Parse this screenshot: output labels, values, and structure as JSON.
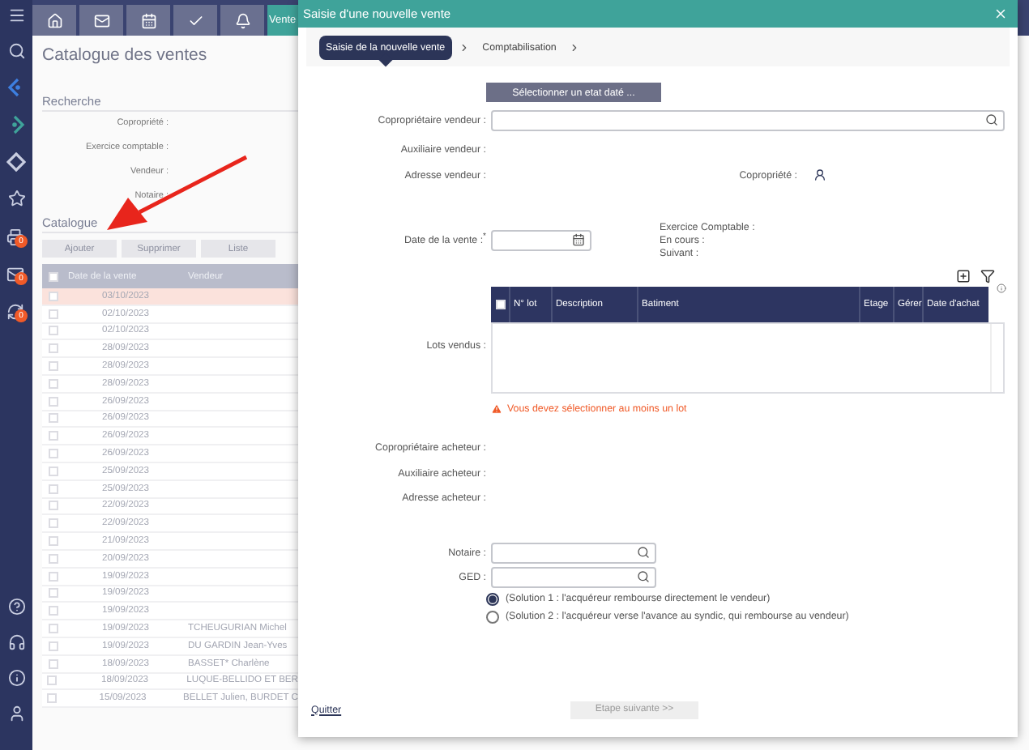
{
  "sidebar": {
    "badges": [
      "0",
      "0",
      "0"
    ]
  },
  "top_tabs": [
    {
      "kind": "home",
      "selected": false
    },
    {
      "kind": "mail",
      "selected": false
    },
    {
      "kind": "calendar",
      "selected": false
    },
    {
      "kind": "check",
      "selected": false
    },
    {
      "kind": "bell",
      "selected": false
    },
    {
      "kind": "text",
      "label": "Vente",
      "selected": true
    }
  ],
  "page_title": "Catalogue des ventes",
  "search": {
    "title": "Recherche",
    "fields": [
      "Copropriété :",
      "Exercice comptable :",
      "Vendeur :",
      "Notaire :"
    ]
  },
  "catalogue": {
    "title": "Catalogue",
    "buttons": [
      "Ajouter",
      "Supprimer",
      "Liste"
    ],
    "columns": [
      "Date de la vente",
      "Vendeur"
    ],
    "header_checked": false,
    "rows": [
      {
        "date": "03/10/2023",
        "selected": true
      },
      {
        "date": "02/10/2023",
        "selected": false
      },
      {
        "date": "02/10/2023",
        "selected": false
      },
      {
        "date": "28/09/2023",
        "selected": false
      },
      {
        "date": "28/09/2023",
        "selected": false
      },
      {
        "date": "28/09/2023",
        "selected": false
      },
      {
        "date": "26/09/2023",
        "selected": false
      },
      {
        "date": "26/09/2023",
        "selected": false
      },
      {
        "date": "26/09/2023",
        "selected": false
      },
      {
        "date": "26/09/2023",
        "selected": false
      },
      {
        "date": "25/09/2023",
        "selected": false
      },
      {
        "date": "25/09/2023",
        "selected": false
      },
      {
        "date": "22/09/2023",
        "selected": false
      },
      {
        "date": "22/09/2023",
        "selected": false
      },
      {
        "date": "21/09/2023",
        "selected": false
      },
      {
        "date": "20/09/2023",
        "selected": false
      },
      {
        "date": "19/09/2023",
        "selected": false
      },
      {
        "date": "19/09/2023",
        "selected": false
      },
      {
        "date": "19/09/2023",
        "selected": false
      },
      {
        "date": "19/09/2023",
        "vendor": "TCHEUGURIAN Michel",
        "selected": false
      },
      {
        "date": "19/09/2023",
        "vendor": "DU GARDIN Jean-Yves",
        "selected": false
      },
      {
        "date": "18/09/2023",
        "vendor": "BASSET* Charlène",
        "selected": false
      },
      {
        "date": "18/09/2023",
        "vendor": "LUQUE-BELLIDO ET BER",
        "selected": false
      },
      {
        "date": "15/09/2023",
        "vendor": "BELLET Julien, BURDET C",
        "selected": false
      }
    ]
  },
  "dialog": {
    "title": "Saisie d'une nouvelle vente",
    "steps": [
      {
        "label": "Saisie de la nouvelle vente",
        "selected": true
      },
      {
        "label": "Comptabilisation",
        "selected": false
      }
    ],
    "select_button": "Sélectionner un etat daté ...",
    "seller_label": "Copropriétaire vendeur :",
    "seller_aux_label": "Auxiliaire vendeur :",
    "seller_address_label": "Adresse vendeur :",
    "copro_label": "Copropriété :",
    "sale_date_label": "Date de la vente :",
    "required_mark": "*",
    "fiscal_labels": [
      "Exercice Comptable :",
      "En cours :",
      "Suivant :"
    ],
    "lots_label": "Lots vendus :",
    "lots_columns": [
      "N° lot",
      "Description",
      "Batiment",
      "Etage",
      "Gérer",
      "Date d'achat"
    ],
    "lots_header_checked": false,
    "warning": "Vous devez sélectionner au moins un lot",
    "buyer_labels": [
      "Copropriétaire acheteur :",
      "Auxiliaire acheteur :",
      "Adresse acheteur :"
    ],
    "notaire_label": "Notaire :",
    "ged_label": "GED :",
    "options": [
      {
        "label": "(Solution 1 : l'acquéreur rembourse directement le vendeur)",
        "selected": true
      },
      {
        "label": "(Solution 2 : l'acquéreur verse l'avance au syndic, qui rembourse au vendeur)",
        "selected": false
      }
    ],
    "quit": "Quitter",
    "next_button": {
      "label": "Etape suivante >>",
      "disabled": true
    }
  }
}
